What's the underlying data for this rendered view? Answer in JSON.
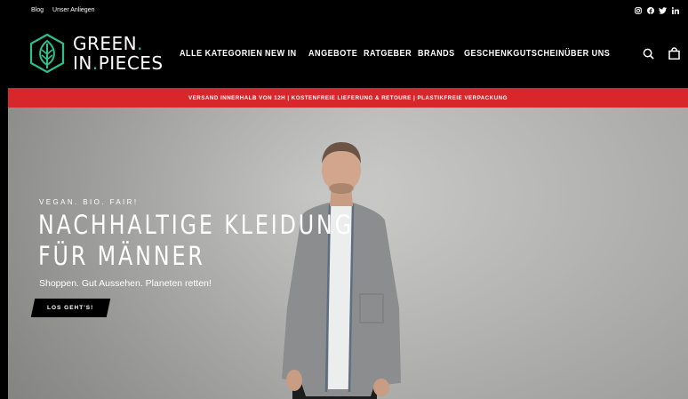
{
  "topbar": {
    "links": [
      "Blog",
      "Unser Anliegen"
    ],
    "socials": [
      "instagram-icon",
      "facebook-icon",
      "twitter-icon",
      "linkedin-icon"
    ]
  },
  "header": {
    "logo_line1": "GREEN",
    "logo_dot": ".",
    "logo_line2a": "IN",
    "logo_line2b": "PIECES",
    "nav": [
      "ALLE KATEGORIEN",
      "NEW IN",
      "ANGEBOTE",
      "RATGEBER",
      "BRANDS",
      "GESCHENKGUTSCHEIN",
      "ÜBER UNS"
    ],
    "icons": [
      "search-icon",
      "cart-icon"
    ]
  },
  "banner": {
    "text": "VERSAND INNERHALB VON 12H | KOSTENFREIE LIEFERUNG & RETOURE | PLASTIKFREIE VERPACKUNG"
  },
  "hero": {
    "eyebrow": "VEGAN. BIO. FAIR!",
    "headline_line1": "NACHHALTIGE KLEIDUNG",
    "headline_line2": "FÜR MÄNNER",
    "subline": "Shoppen. Gut Aussehen. Planeten retten!",
    "cta_label": "LOS GEHT'S!"
  },
  "colors": {
    "background": "#000000",
    "banner": "#d8272a",
    "brand_green": "#2fbf8f"
  }
}
